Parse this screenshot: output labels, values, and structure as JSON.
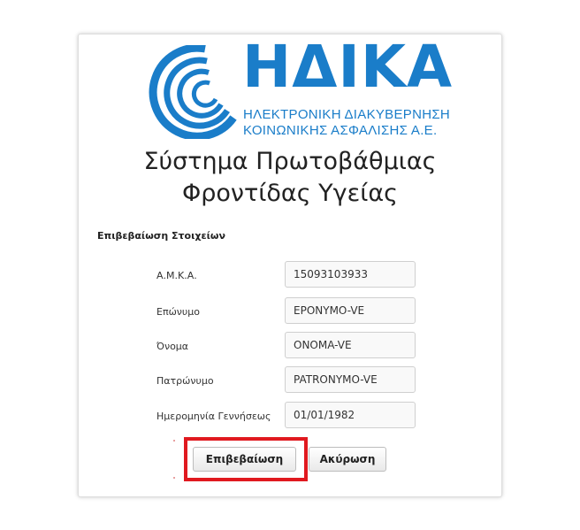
{
  "branding": {
    "name": "ΗΔΙΚΑ",
    "subtitle_line1": "ΗΛΕΚΤΡΟΝΙΚΗ ΔΙΑΚΥΒΕΡΝΗΣΗ",
    "subtitle_line2": "ΚΟΙΝΩΝΙΚΗΣ ΑΣΦΑΛΙΣΗΣ Α.Ε.",
    "brand_color": "#1a7dc9",
    "logo_icon": "concentric-arcs-logo-icon"
  },
  "page": {
    "title_line1": "Σύστημα Πρωτοβάθμιας",
    "title_line2": "Φροντίδας Υγείας"
  },
  "form": {
    "section_title": "Επιβεβαίωση Στοιχείων",
    "fields": [
      {
        "label": "Α.Μ.Κ.Α.",
        "value": "15093103933"
      },
      {
        "label": "Επώνυμο",
        "value": "EPONYMO-VE"
      },
      {
        "label": "Όνομα",
        "value": "ONOMA-VE"
      },
      {
        "label": "Πατρώνυμο",
        "value": "PATRONYMO-VE"
      },
      {
        "label": "Ημερομηνία Γεννήσεως",
        "value": "01/01/1982"
      }
    ]
  },
  "actions": {
    "confirm_label": "Επιβεβαίωση",
    "cancel_label": "Ακύρωση",
    "highlight_color": "#e0191f"
  }
}
